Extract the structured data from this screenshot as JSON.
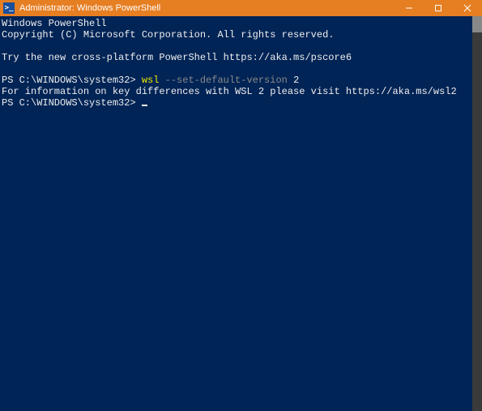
{
  "window": {
    "title": "Administrator: Windows PowerShell",
    "icon_glyph": ">_"
  },
  "terminal": {
    "header_line1": "Windows PowerShell",
    "header_line2": "Copyright (C) Microsoft Corporation. All rights reserved.",
    "try_line": "Try the new cross-platform PowerShell https://aka.ms/pscore6",
    "prompt1_prefix": "PS C:\\WINDOWS\\system32> ",
    "prompt1_cmd": "wsl",
    "prompt1_flag": " --set-default-version",
    "prompt1_arg": " 2",
    "output1": "For information on key differences with WSL 2 please visit https://aka.ms/wsl2",
    "prompt2": "PS C:\\WINDOWS\\system32> "
  },
  "controls": {
    "minimize": "minimize",
    "maximize": "maximize",
    "close": "close"
  }
}
